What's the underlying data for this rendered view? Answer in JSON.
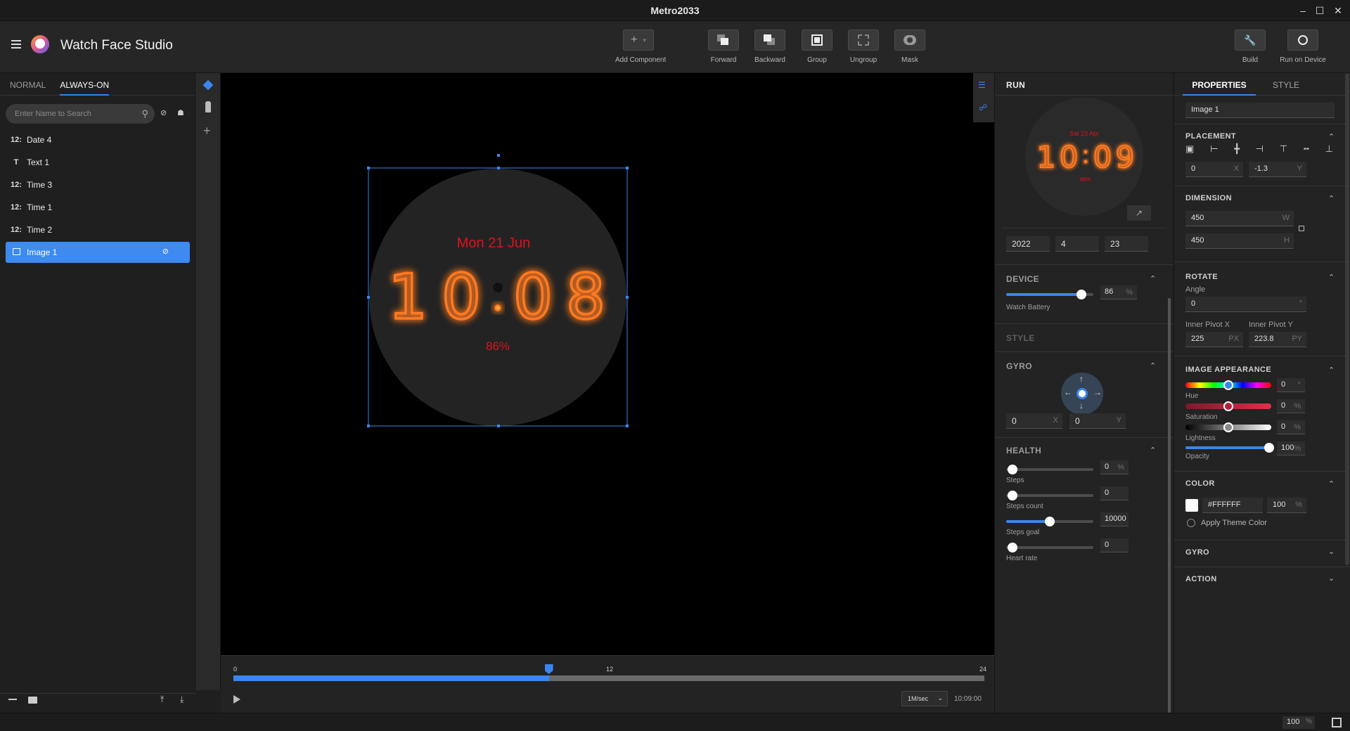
{
  "window": {
    "title": "Metro2033",
    "minimize": "–",
    "maximize": "☐",
    "close": "✕"
  },
  "app": {
    "name": "Watch Face Studio"
  },
  "toolbar": {
    "add_component": "Add Component",
    "forward": "Forward",
    "backward": "Backward",
    "group": "Group",
    "ungroup": "Ungroup",
    "mask": "Mask",
    "build": "Build",
    "run_on_device": "Run on Device"
  },
  "left_tabs": {
    "normal": "NORMAL",
    "always_on": "ALWAYS-ON",
    "active": "ALWAYS-ON"
  },
  "search": {
    "placeholder": "Enter Name to Search"
  },
  "layers": [
    {
      "icon": "12:",
      "name": "Date 4",
      "selected": false
    },
    {
      "icon": "T",
      "name": "Text 1",
      "selected": false
    },
    {
      "icon": "12:",
      "name": "Time 3",
      "selected": false
    },
    {
      "icon": "12:",
      "name": "Time 1",
      "selected": false
    },
    {
      "icon": "12:",
      "name": "Time 2",
      "selected": false
    },
    {
      "icon": "image-icon",
      "name": "Image 1",
      "selected": true
    }
  ],
  "watchface": {
    "date": "Mon 21 Jun",
    "digits": [
      "1",
      "0",
      "0",
      "8"
    ],
    "battery": "86%"
  },
  "timeline": {
    "start": "0",
    "mid": "12",
    "end": "24",
    "position_fraction": 0.42,
    "speed": "1M/sec",
    "time": "10:09:00"
  },
  "run": {
    "title": "RUN",
    "preview": {
      "date": "Sat 23 Apr",
      "digits": [
        "1",
        "0",
        "0",
        "9"
      ],
      "battery": "86%"
    },
    "date_year": "2022",
    "date_month": "4",
    "date_day": "23",
    "device": {
      "title": "DEVICE",
      "battery_label": "Watch Battery",
      "battery_value": "86",
      "battery_unit": "%"
    },
    "style_title": "STYLE",
    "gyro": {
      "title": "GYRO",
      "x": "0",
      "y": "0",
      "x_unit": "X",
      "y_unit": "Y"
    },
    "health": {
      "title": "HEALTH",
      "steps_label": "Steps",
      "steps_value": "0",
      "steps_unit": "%",
      "steps_count_label": "Steps count",
      "steps_count_value": "0",
      "steps_goal_label": "Steps goal",
      "steps_goal_value": "10000",
      "steps_goal_fraction": 0.5,
      "heart_label": "Heart rate",
      "heart_value": "0"
    }
  },
  "props": {
    "tab_properties": "PROPERTIES",
    "tab_style": "STYLE",
    "name": "Image 1",
    "placement": {
      "title": "PLACEMENT",
      "x": "0",
      "y": "-1.3",
      "x_unit": "X",
      "y_unit": "Y"
    },
    "dimension": {
      "title": "DIMENSION",
      "w": "450",
      "h": "450",
      "w_unit": "W",
      "h_unit": "H"
    },
    "rotate": {
      "title": "ROTATE",
      "angle_label": "Angle",
      "angle": "0",
      "angle_unit": "°",
      "pivot_x_label": "Inner Pivot X",
      "pivot_y_label": "Inner Pivot Y",
      "pivot_x": "225",
      "pivot_y": "223.8",
      "px_unit": "PX",
      "py_unit": "PY"
    },
    "appearance": {
      "title": "IMAGE APPEARANCE",
      "hue_label": "Hue",
      "hue": "0",
      "hue_unit": "°",
      "sat_label": "Saturation",
      "sat": "0",
      "sat_unit": "%",
      "light_label": "Lightness",
      "light": "0",
      "light_unit": "%",
      "opacity_label": "Opacity",
      "opacity": "100",
      "opacity_unit": "%"
    },
    "color": {
      "title": "COLOR",
      "hex": "#FFFFFF",
      "alpha": "100",
      "alpha_unit": "%",
      "theme_label": "Apply Theme Color"
    },
    "gyro_title": "GYRO",
    "action_title": "ACTION"
  },
  "status": {
    "zoom": "100",
    "zoom_unit": "%"
  },
  "colors": {
    "accent": "#3a86ee",
    "watch_text": "#e0111e",
    "nixie": "#ff7a22"
  }
}
